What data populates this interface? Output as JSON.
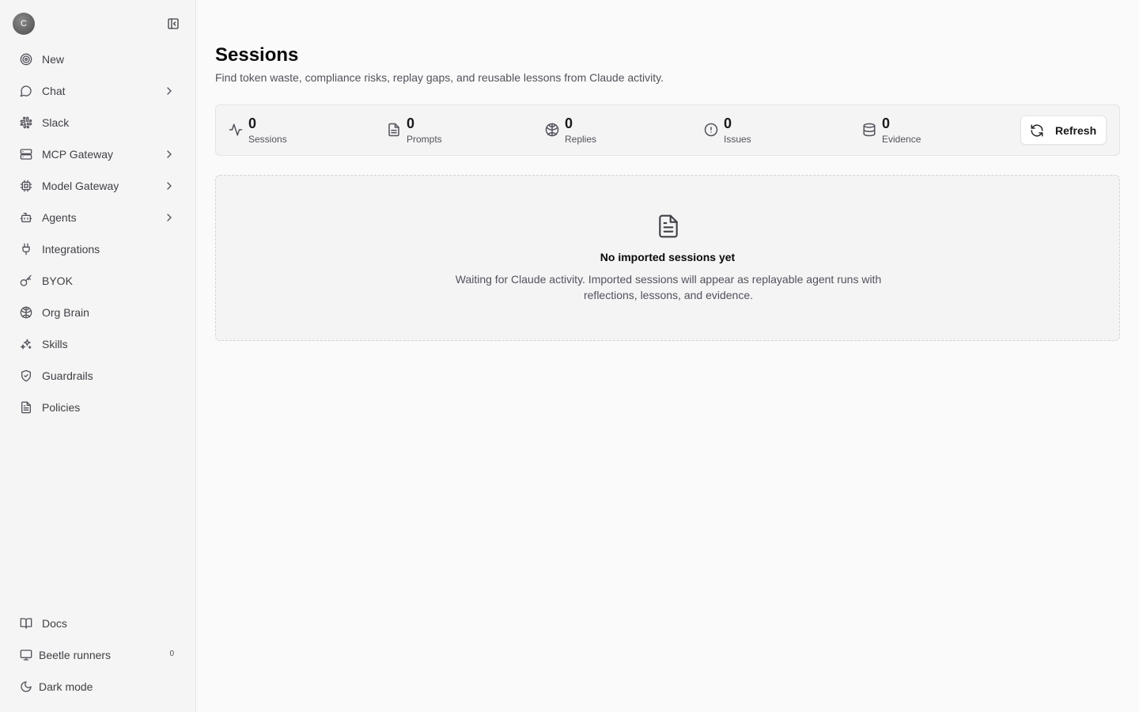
{
  "sidebar": {
    "avatar_initial": "C",
    "items": [
      {
        "label": "New",
        "icon": "target-icon"
      },
      {
        "label": "Chat",
        "icon": "chat-bubble-icon"
      },
      {
        "label": "Slack",
        "icon": "slack-icon"
      },
      {
        "label": "MCP Gateway",
        "icon": "server-icon"
      },
      {
        "label": "Model Gateway",
        "icon": "cpu-icon"
      },
      {
        "label": "Agents",
        "icon": "bot-icon"
      },
      {
        "label": "Integrations",
        "icon": "plug-icon"
      },
      {
        "label": "BYOK",
        "icon": "key-icon"
      },
      {
        "label": "Org Brain",
        "icon": "brain-icon"
      },
      {
        "label": "Skills",
        "icon": "sparkles-icon"
      },
      {
        "label": "Guardrails",
        "icon": "shield-check-icon"
      },
      {
        "label": "Policies",
        "icon": "file-text-icon"
      }
    ],
    "bottom": {
      "docs": "Docs",
      "runners": "Beetle runners",
      "runners_count": "0",
      "dark_mode": "Dark mode"
    }
  },
  "page": {
    "title": "Sessions",
    "subtitle": "Find token waste, compliance risks, replay gaps, and reusable lessons from Claude activity."
  },
  "stats": [
    {
      "value": "0",
      "label": "Sessions",
      "icon": "activity-icon"
    },
    {
      "value": "0",
      "label": "Prompts",
      "icon": "file-icon"
    },
    {
      "value": "0",
      "label": "Replies",
      "icon": "brain-icon"
    },
    {
      "value": "0",
      "label": "Issues",
      "icon": "alert-circle-icon"
    },
    {
      "value": "0",
      "label": "Evidence",
      "icon": "database-icon"
    }
  ],
  "refresh_label": "Refresh",
  "empty_state": {
    "title": "No imported sessions yet",
    "description": "Waiting for Claude activity. Imported sessions will appear as replayable agent runs with reflections, lessons, and evidence."
  }
}
